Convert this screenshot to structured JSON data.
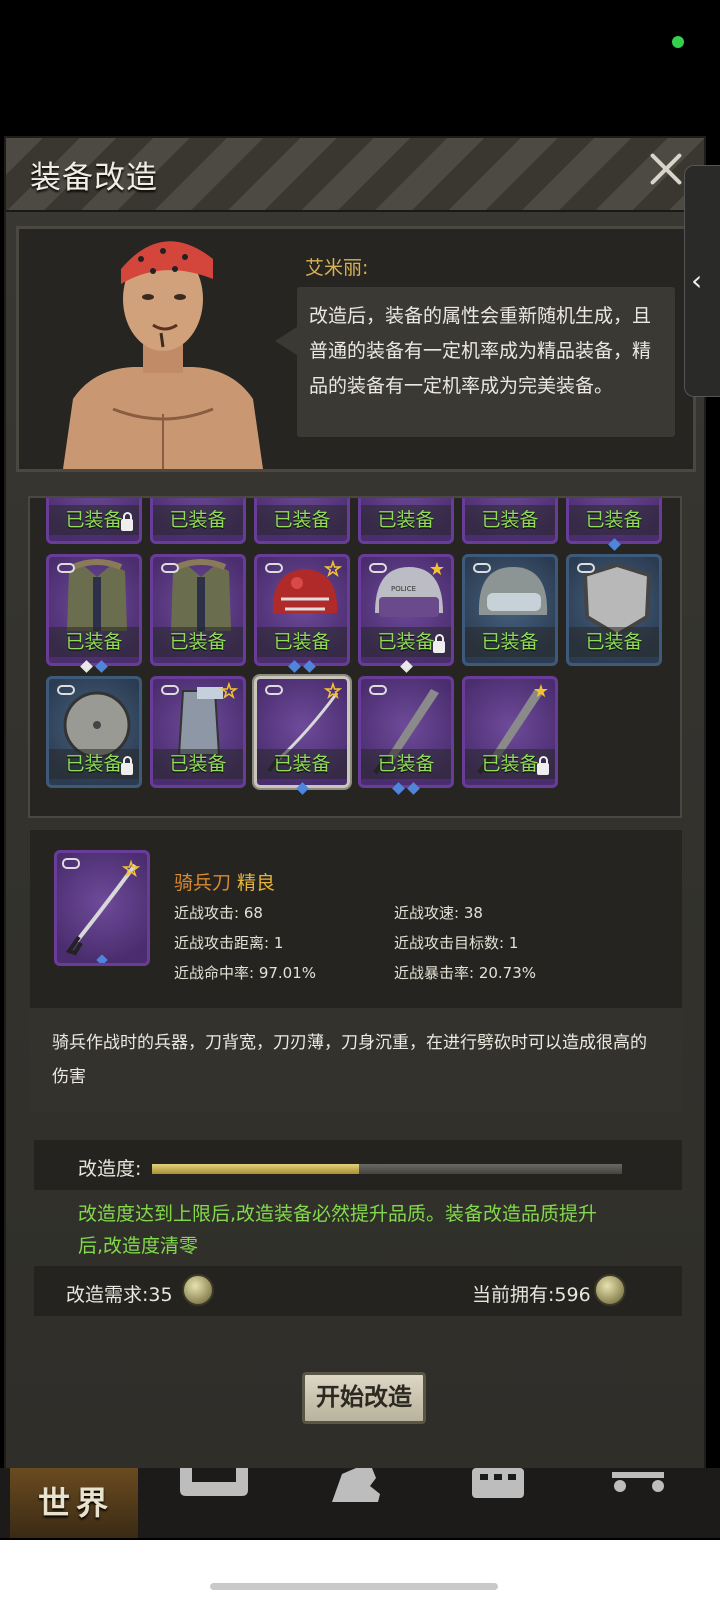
{
  "panel": {
    "title": "装备改造"
  },
  "dialog": {
    "speaker": "艾米丽:",
    "text": "改造后，装备的属性会重新随机生成，且普通的装备有一定机率成为精品装备，精品的装备有一定机率成为完美装备。"
  },
  "inventory": {
    "slot_label": "已装备",
    "rows": [
      [
        {
          "item": "partial",
          "color": "purple",
          "lock": true
        },
        {
          "item": "partial",
          "color": "purple"
        },
        {
          "item": "partial",
          "color": "purple"
        },
        {
          "item": "partial",
          "color": "purple"
        },
        {
          "item": "partial",
          "color": "purple"
        },
        {
          "item": "partial",
          "color": "purple",
          "gems": [
            "b"
          ]
        }
      ],
      [
        {
          "item": "coat",
          "color": "purple",
          "link": true,
          "gems": [
            "w",
            "b"
          ]
        },
        {
          "item": "coat",
          "color": "purple",
          "link": true
        },
        {
          "item": "football-helmet",
          "color": "purple",
          "link": true,
          "star": "outline",
          "gems": [
            "b",
            "b"
          ]
        },
        {
          "item": "police-helmet",
          "color": "purple",
          "link": true,
          "star": "filled",
          "lock": true,
          "gems": [
            "w"
          ]
        },
        {
          "item": "motorcycle-helmet",
          "color": "blue",
          "link": true
        },
        {
          "item": "shield",
          "color": "blue",
          "link": true
        }
      ],
      [
        {
          "item": "round-shield",
          "color": "blue",
          "link": true,
          "lock": true
        },
        {
          "item": "arm-guard",
          "color": "purple",
          "link": true,
          "star": "outline"
        },
        {
          "item": "sabre",
          "color": "purple",
          "link": true,
          "star": "outline",
          "selected": true,
          "gems": [
            "b"
          ]
        },
        {
          "item": "machete",
          "color": "purple",
          "link": true,
          "gems": [
            "b",
            "b"
          ]
        },
        {
          "item": "machete",
          "color": "purple",
          "star": "filled",
          "lock": true
        }
      ]
    ]
  },
  "detail": {
    "name": "骑兵刀",
    "quality": "精良",
    "stats": [
      "近战攻击: 68",
      "近战攻速: 38",
      "近战攻击距离: 1",
      "近战攻击目标数: 1",
      "近战命中率: 97.01%",
      "近战暴击率: 20.73%"
    ],
    "description": "骑兵作战时的兵器，刀背宽，刀刃薄，刀身沉重，在进行劈砍时可以造成很高的伤害"
  },
  "modification": {
    "label": "改造度:",
    "progress": 0.44,
    "info": "改造度达到上限后,改造装备必然提升品质。装备改造品质提升后,改造度清零",
    "requirement": "改造需求:35",
    "owned": "当前拥有:596"
  },
  "start_button": "开始改造",
  "nav": {
    "world": "世界"
  },
  "colors": {
    "label_green": "#8fdc57",
    "quality_orange": "#d9892f",
    "purple_slot": "#6a3c9a",
    "blue_slot": "#3d5a7a"
  }
}
